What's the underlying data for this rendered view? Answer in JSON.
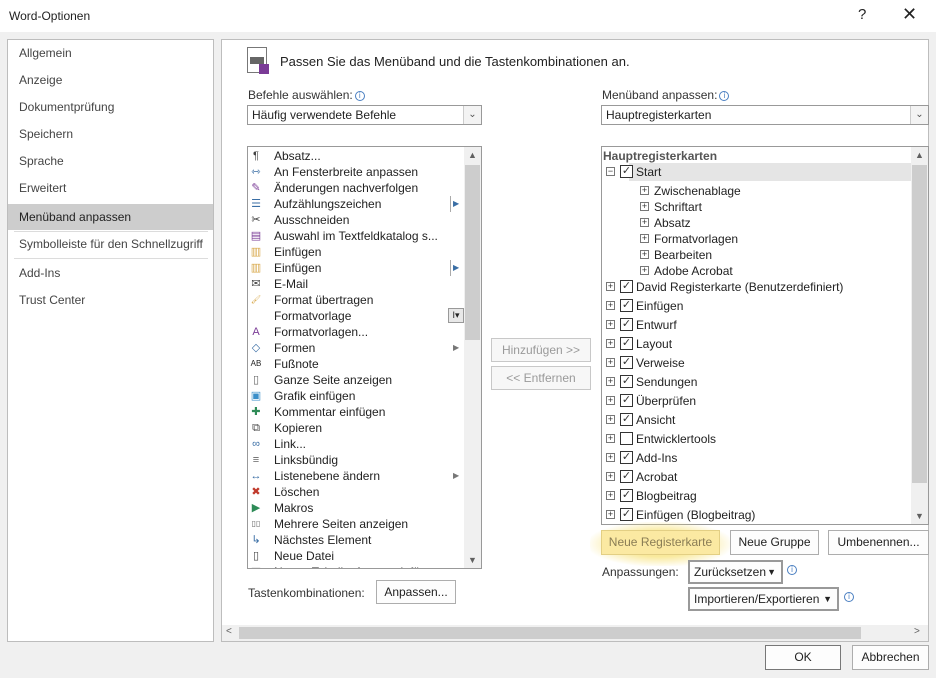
{
  "window": {
    "title": "Word-Optionen",
    "help": "?",
    "close": "✕"
  },
  "nav": {
    "items": [
      {
        "label": "Allgemein"
      },
      {
        "label": "Anzeige"
      },
      {
        "label": "Dokumentprüfung"
      },
      {
        "label": "Speichern"
      },
      {
        "label": "Sprache"
      },
      {
        "label": "Erweitert"
      },
      {
        "label": "Menüband anpassen",
        "selected": true
      },
      {
        "label": "Symbolleiste für den Schnellzugriff"
      },
      {
        "label": "Add-Ins"
      },
      {
        "label": "Trust Center"
      }
    ]
  },
  "header": {
    "text": "Passen Sie das Menüband und die Tastenkombinationen an."
  },
  "commands": {
    "label": "Befehle auswählen:",
    "select_value": "Häufig verwendete Befehle",
    "items": [
      {
        "label": "Absatz...",
        "icon": "paragraph-icon"
      },
      {
        "label": "An Fensterbreite anpassen",
        "icon": "fit-width-icon"
      },
      {
        "label": "Änderungen nachverfolgen",
        "icon": "track-changes-icon"
      },
      {
        "label": "Aufzählungszeichen",
        "icon": "bullets-icon",
        "submenu": "split"
      },
      {
        "label": "Ausschneiden",
        "icon": "scissors-icon"
      },
      {
        "label": "Auswahl im Textfeldkatalog s...",
        "icon": "save-selection-icon"
      },
      {
        "label": "Einfügen",
        "icon": "paste-icon"
      },
      {
        "label": "Einfügen",
        "icon": "paste-icon",
        "submenu": "split"
      },
      {
        "label": "E-Mail",
        "icon": "email-icon"
      },
      {
        "label": "Format übertragen",
        "icon": "format-painter-icon"
      },
      {
        "label": "Formatvorlage",
        "icon": "",
        "submenu": "style"
      },
      {
        "label": "Formatvorlagen...",
        "icon": "styles-icon"
      },
      {
        "label": "Formen",
        "icon": "shapes-icon",
        "submenu": "arrow"
      },
      {
        "label": "Fußnote",
        "icon": "footnote-icon"
      },
      {
        "label": "Ganze Seite anzeigen",
        "icon": "page-icon"
      },
      {
        "label": "Grafik einfügen",
        "icon": "picture-icon"
      },
      {
        "label": "Kommentar einfügen",
        "icon": "comment-add-icon"
      },
      {
        "label": "Kopieren",
        "icon": "copy-icon"
      },
      {
        "label": "Link...",
        "icon": "link-icon"
      },
      {
        "label": "Linksbündig",
        "icon": "align-left-icon"
      },
      {
        "label": "Listenebene ändern",
        "icon": "list-level-icon",
        "submenu": "arrow"
      },
      {
        "label": "Löschen",
        "icon": "comment-delete-icon"
      },
      {
        "label": "Makros",
        "icon": "macro-play-icon"
      },
      {
        "label": "Mehrere Seiten anzeigen",
        "icon": "multi-page-icon"
      },
      {
        "label": "Nächstes Element",
        "icon": "next-comment-icon"
      },
      {
        "label": "Neue Datei",
        "icon": "new-file-icon"
      },
      {
        "label": "Neues Tabellenformat einfügen",
        "icon": "table-icon"
      }
    ],
    "add_button": "Hinzufügen >>",
    "remove_button": "<< Entfernen",
    "shortcuts_label": "Tastenkombinationen:",
    "shortcuts_button": "Anpassen..."
  },
  "ribbon": {
    "label": "Menüband anpassen:",
    "select_value": "Hauptregisterkarten",
    "tree_header": "Hauptregisterkarten",
    "start": {
      "label": "Start",
      "checked": true,
      "groups": [
        "Zwischenablage",
        "Schriftart",
        "Absatz",
        "Formatvorlagen",
        "Bearbeiten",
        "Adobe Acrobat"
      ]
    },
    "tabs": [
      {
        "label": "David Registerkarte (Benutzerdefiniert)",
        "checked": true
      },
      {
        "label": "Einfügen",
        "checked": true
      },
      {
        "label": "Entwurf",
        "checked": true
      },
      {
        "label": "Layout",
        "checked": true
      },
      {
        "label": "Verweise",
        "checked": true
      },
      {
        "label": "Sendungen",
        "checked": true
      },
      {
        "label": "Überprüfen",
        "checked": true
      },
      {
        "label": "Ansicht",
        "checked": true
      },
      {
        "label": "Entwicklertools",
        "checked": false
      },
      {
        "label": "Add-Ins",
        "checked": true
      },
      {
        "label": "Acrobat",
        "checked": true
      },
      {
        "label": "Blogbeitrag",
        "checked": true
      },
      {
        "label": "Einfügen (Blogbeitrag)",
        "checked": true
      }
    ],
    "new_tab_button": "Neue Registerkarte",
    "new_group_button": "Neue Gruppe",
    "rename_button": "Umbenennen...",
    "customizations_label": "Anpassungen:",
    "reset_button": "Zurücksetzen",
    "import_export_button": "Importieren/Exportieren"
  },
  "footer": {
    "ok": "OK",
    "cancel": "Abbrechen"
  },
  "colors": {
    "highlight_glow": "#f7e27a",
    "selected_nav": "#cdcdcd",
    "accent_info": "#4a7fc1"
  }
}
